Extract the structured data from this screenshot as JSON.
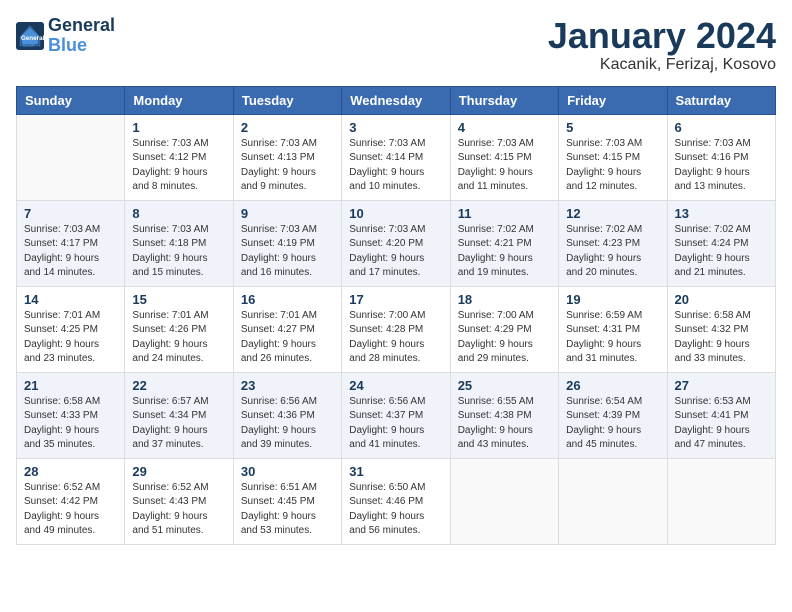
{
  "header": {
    "logo_line1": "General",
    "logo_line2": "Blue",
    "title": "January 2024",
    "subtitle": "Kacanik, Ferizaj, Kosovo"
  },
  "days_of_week": [
    "Sunday",
    "Monday",
    "Tuesday",
    "Wednesday",
    "Thursday",
    "Friday",
    "Saturday"
  ],
  "weeks": [
    [
      {
        "day": "",
        "sunrise": "",
        "sunset": "",
        "daylight": ""
      },
      {
        "day": "1",
        "sunrise": "Sunrise: 7:03 AM",
        "sunset": "Sunset: 4:12 PM",
        "daylight": "Daylight: 9 hours and 8 minutes."
      },
      {
        "day": "2",
        "sunrise": "Sunrise: 7:03 AM",
        "sunset": "Sunset: 4:13 PM",
        "daylight": "Daylight: 9 hours and 9 minutes."
      },
      {
        "day": "3",
        "sunrise": "Sunrise: 7:03 AM",
        "sunset": "Sunset: 4:14 PM",
        "daylight": "Daylight: 9 hours and 10 minutes."
      },
      {
        "day": "4",
        "sunrise": "Sunrise: 7:03 AM",
        "sunset": "Sunset: 4:15 PM",
        "daylight": "Daylight: 9 hours and 11 minutes."
      },
      {
        "day": "5",
        "sunrise": "Sunrise: 7:03 AM",
        "sunset": "Sunset: 4:15 PM",
        "daylight": "Daylight: 9 hours and 12 minutes."
      },
      {
        "day": "6",
        "sunrise": "Sunrise: 7:03 AM",
        "sunset": "Sunset: 4:16 PM",
        "daylight": "Daylight: 9 hours and 13 minutes."
      }
    ],
    [
      {
        "day": "7",
        "sunrise": "Sunrise: 7:03 AM",
        "sunset": "Sunset: 4:17 PM",
        "daylight": "Daylight: 9 hours and 14 minutes."
      },
      {
        "day": "8",
        "sunrise": "Sunrise: 7:03 AM",
        "sunset": "Sunset: 4:18 PM",
        "daylight": "Daylight: 9 hours and 15 minutes."
      },
      {
        "day": "9",
        "sunrise": "Sunrise: 7:03 AM",
        "sunset": "Sunset: 4:19 PM",
        "daylight": "Daylight: 9 hours and 16 minutes."
      },
      {
        "day": "10",
        "sunrise": "Sunrise: 7:03 AM",
        "sunset": "Sunset: 4:20 PM",
        "daylight": "Daylight: 9 hours and 17 minutes."
      },
      {
        "day": "11",
        "sunrise": "Sunrise: 7:02 AM",
        "sunset": "Sunset: 4:21 PM",
        "daylight": "Daylight: 9 hours and 19 minutes."
      },
      {
        "day": "12",
        "sunrise": "Sunrise: 7:02 AM",
        "sunset": "Sunset: 4:23 PM",
        "daylight": "Daylight: 9 hours and 20 minutes."
      },
      {
        "day": "13",
        "sunrise": "Sunrise: 7:02 AM",
        "sunset": "Sunset: 4:24 PM",
        "daylight": "Daylight: 9 hours and 21 minutes."
      }
    ],
    [
      {
        "day": "14",
        "sunrise": "Sunrise: 7:01 AM",
        "sunset": "Sunset: 4:25 PM",
        "daylight": "Daylight: 9 hours and 23 minutes."
      },
      {
        "day": "15",
        "sunrise": "Sunrise: 7:01 AM",
        "sunset": "Sunset: 4:26 PM",
        "daylight": "Daylight: 9 hours and 24 minutes."
      },
      {
        "day": "16",
        "sunrise": "Sunrise: 7:01 AM",
        "sunset": "Sunset: 4:27 PM",
        "daylight": "Daylight: 9 hours and 26 minutes."
      },
      {
        "day": "17",
        "sunrise": "Sunrise: 7:00 AM",
        "sunset": "Sunset: 4:28 PM",
        "daylight": "Daylight: 9 hours and 28 minutes."
      },
      {
        "day": "18",
        "sunrise": "Sunrise: 7:00 AM",
        "sunset": "Sunset: 4:29 PM",
        "daylight": "Daylight: 9 hours and 29 minutes."
      },
      {
        "day": "19",
        "sunrise": "Sunrise: 6:59 AM",
        "sunset": "Sunset: 4:31 PM",
        "daylight": "Daylight: 9 hours and 31 minutes."
      },
      {
        "day": "20",
        "sunrise": "Sunrise: 6:58 AM",
        "sunset": "Sunset: 4:32 PM",
        "daylight": "Daylight: 9 hours and 33 minutes."
      }
    ],
    [
      {
        "day": "21",
        "sunrise": "Sunrise: 6:58 AM",
        "sunset": "Sunset: 4:33 PM",
        "daylight": "Daylight: 9 hours and 35 minutes."
      },
      {
        "day": "22",
        "sunrise": "Sunrise: 6:57 AM",
        "sunset": "Sunset: 4:34 PM",
        "daylight": "Daylight: 9 hours and 37 minutes."
      },
      {
        "day": "23",
        "sunrise": "Sunrise: 6:56 AM",
        "sunset": "Sunset: 4:36 PM",
        "daylight": "Daylight: 9 hours and 39 minutes."
      },
      {
        "day": "24",
        "sunrise": "Sunrise: 6:56 AM",
        "sunset": "Sunset: 4:37 PM",
        "daylight": "Daylight: 9 hours and 41 minutes."
      },
      {
        "day": "25",
        "sunrise": "Sunrise: 6:55 AM",
        "sunset": "Sunset: 4:38 PM",
        "daylight": "Daylight: 9 hours and 43 minutes."
      },
      {
        "day": "26",
        "sunrise": "Sunrise: 6:54 AM",
        "sunset": "Sunset: 4:39 PM",
        "daylight": "Daylight: 9 hours and 45 minutes."
      },
      {
        "day": "27",
        "sunrise": "Sunrise: 6:53 AM",
        "sunset": "Sunset: 4:41 PM",
        "daylight": "Daylight: 9 hours and 47 minutes."
      }
    ],
    [
      {
        "day": "28",
        "sunrise": "Sunrise: 6:52 AM",
        "sunset": "Sunset: 4:42 PM",
        "daylight": "Daylight: 9 hours and 49 minutes."
      },
      {
        "day": "29",
        "sunrise": "Sunrise: 6:52 AM",
        "sunset": "Sunset: 4:43 PM",
        "daylight": "Daylight: 9 hours and 51 minutes."
      },
      {
        "day": "30",
        "sunrise": "Sunrise: 6:51 AM",
        "sunset": "Sunset: 4:45 PM",
        "daylight": "Daylight: 9 hours and 53 minutes."
      },
      {
        "day": "31",
        "sunrise": "Sunrise: 6:50 AM",
        "sunset": "Sunset: 4:46 PM",
        "daylight": "Daylight: 9 hours and 56 minutes."
      },
      {
        "day": "",
        "sunrise": "",
        "sunset": "",
        "daylight": ""
      },
      {
        "day": "",
        "sunrise": "",
        "sunset": "",
        "daylight": ""
      },
      {
        "day": "",
        "sunrise": "",
        "sunset": "",
        "daylight": ""
      }
    ]
  ]
}
